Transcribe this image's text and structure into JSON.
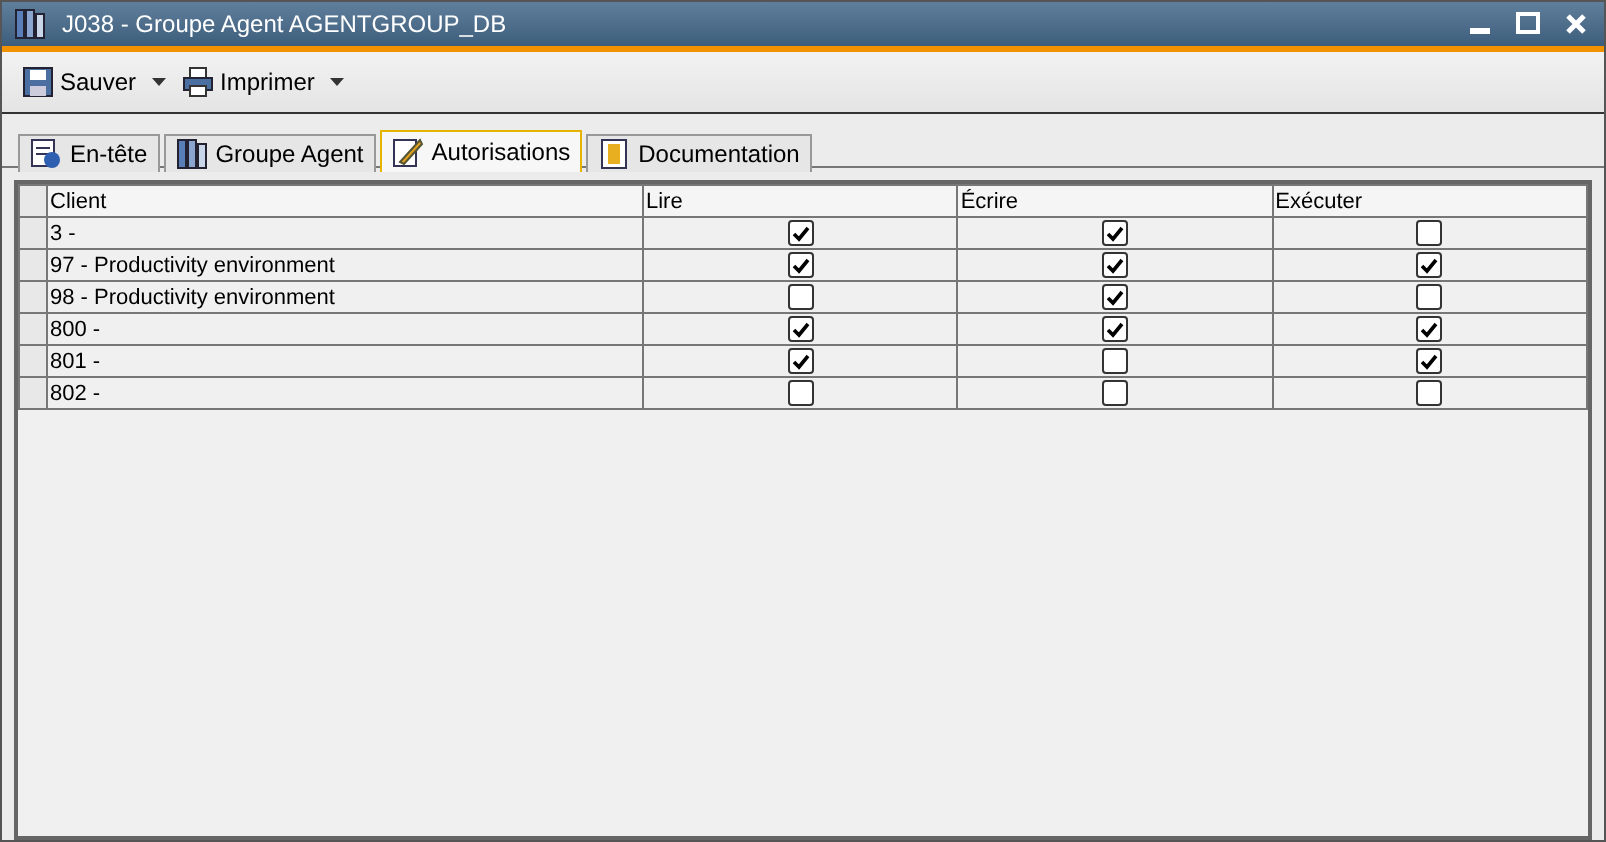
{
  "window": {
    "title": "J038 - Groupe Agent AGENTGROUP_DB"
  },
  "toolbar": [
    {
      "label": "Sauver"
    },
    {
      "label": "Imprimer"
    }
  ],
  "tabs": [
    {
      "label": "En-tête",
      "selected": false
    },
    {
      "label": "Groupe Agent",
      "selected": false
    },
    {
      "label": "Autorisations",
      "selected": true
    },
    {
      "label": "Documentation",
      "selected": false
    }
  ],
  "table": {
    "columns": [
      "Client",
      "Lire",
      "Écrire",
      "Exécuter"
    ],
    "rows": [
      {
        "client": "3 -",
        "read": true,
        "write": true,
        "execute": false
      },
      {
        "client": "97 - Productivity environment",
        "read": true,
        "write": true,
        "execute": true
      },
      {
        "client": "98 - Productivity environment",
        "read": false,
        "write": true,
        "execute": false
      },
      {
        "client": "800 -",
        "read": true,
        "write": true,
        "execute": true
      },
      {
        "client": "801 -",
        "read": true,
        "write": false,
        "execute": true
      },
      {
        "client": "802 -",
        "read": false,
        "write": false,
        "execute": false
      }
    ]
  }
}
